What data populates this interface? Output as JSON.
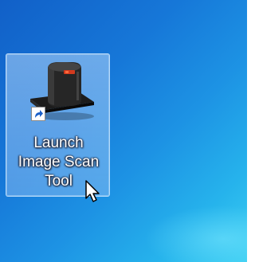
{
  "desktop": {
    "shortcut": {
      "label_line1": "Launch",
      "label_line2": "Image Scan",
      "label_line3": "Tool",
      "icon": "film-scanner-icon",
      "overlay_icon": "shortcut-arrow-icon",
      "state": "selected"
    },
    "cursor": "mouse-pointer-icon",
    "colors": {
      "background_top_left": "#1160c8",
      "background_bottom_right": "#3ccff2",
      "selection": "#b4d7fa"
    }
  }
}
